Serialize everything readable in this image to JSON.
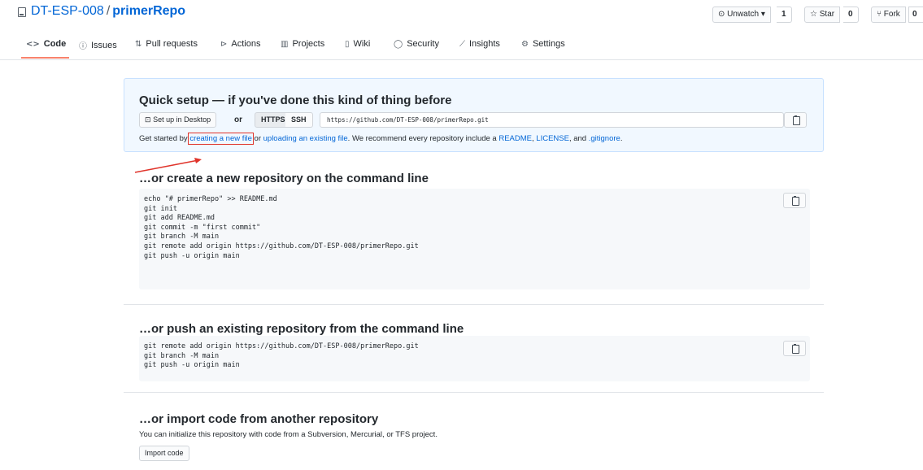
{
  "header": {
    "owner": "DT-ESP-008",
    "separator": "/",
    "repo": "primerRepo",
    "unwatch_label": "Unwatch ▾",
    "unwatch_count": "1",
    "star_label": "Star",
    "star_count": "0",
    "fork_label": "Fork",
    "fork_count": "0"
  },
  "tabs": [
    {
      "label": "Code",
      "icon": "code-icon"
    },
    {
      "label": "Issues",
      "icon": "issue-icon"
    },
    {
      "label": "Pull requests",
      "icon": "pull-request-icon"
    },
    {
      "label": "Actions",
      "icon": "play-icon"
    },
    {
      "label": "Projects",
      "icon": "project-icon"
    },
    {
      "label": "Wiki",
      "icon": "book-icon"
    },
    {
      "label": "Security",
      "icon": "shield-icon"
    },
    {
      "label": "Insights",
      "icon": "graph-icon"
    },
    {
      "label": "Settings",
      "icon": "gear-icon"
    }
  ],
  "quick_setup": {
    "title": "Quick setup — if you've done this kind of thing before",
    "desktop_label": "Set up in Desktop",
    "or_label": "or",
    "https_label": "HTTPS",
    "ssh_label": "SSH",
    "clone_url": "https://github.com/DT-ESP-008/primerRepo.git",
    "get_started_prefix": "Get started by ",
    "create_link": "creating a new file",
    "or_text": " or ",
    "upload_link": "uploading an existing file",
    "recommend_text": ". We recommend every repository include a ",
    "readme_link": "README",
    "comma": ", ",
    "license_link": "LICENSE",
    "and_text": ", and ",
    "gitignore_link": ".gitignore",
    "period": "."
  },
  "new_repo": {
    "title": "…or create a new repository on the command line",
    "code": "echo \"# primerRepo\" >> README.md\ngit init\ngit add README.md\ngit commit -m \"first commit\"\ngit branch -M main\ngit remote add origin https://github.com/DT-ESP-008/primerRepo.git\ngit push -u origin main"
  },
  "push_existing": {
    "title": "…or push an existing repository from the command line",
    "code": "git remote add origin https://github.com/DT-ESP-008/primerRepo.git\ngit branch -M main\ngit push -u origin main"
  },
  "import": {
    "title": "…or import code from another repository",
    "description": "You can initialize this repository with code from a Subversion, Mercurial, or TFS project.",
    "button_label": "Import code"
  },
  "colors": {
    "link": "#0366d6",
    "active_tab_underline": "#f9826c",
    "annotation_red": "#e0342b",
    "quick_setup_bg": "#f1f8ff"
  }
}
